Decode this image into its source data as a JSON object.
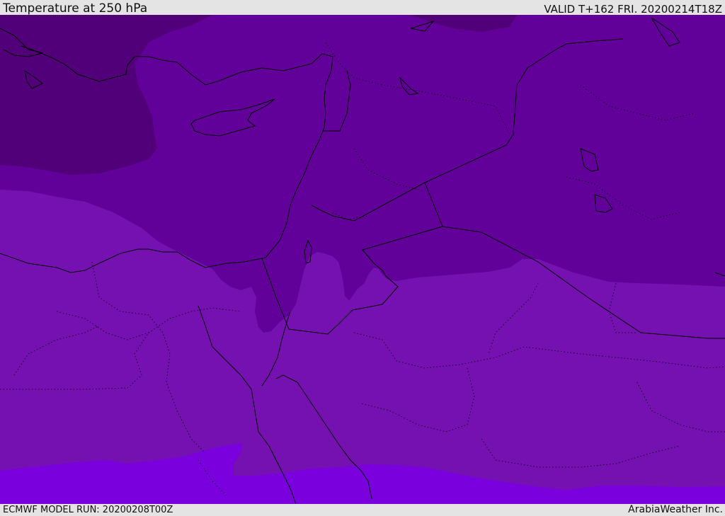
{
  "header": {
    "title": "Temperature at 250 hPa",
    "valid": "VALID T+162 FRI. 20200214T18Z"
  },
  "footer": {
    "model_run": "ECMWF MODEL RUN: 20200208T00Z",
    "credit": "ArabiaWeather Inc."
  },
  "map": {
    "field": "temperature-250hPa",
    "band_colors": {
      "coldest": "#520079",
      "cold": "#62009a",
      "mid": "#7511b0",
      "warm": "#7a00de"
    },
    "coastline_color": "#000000",
    "border_style": "dotted"
  }
}
